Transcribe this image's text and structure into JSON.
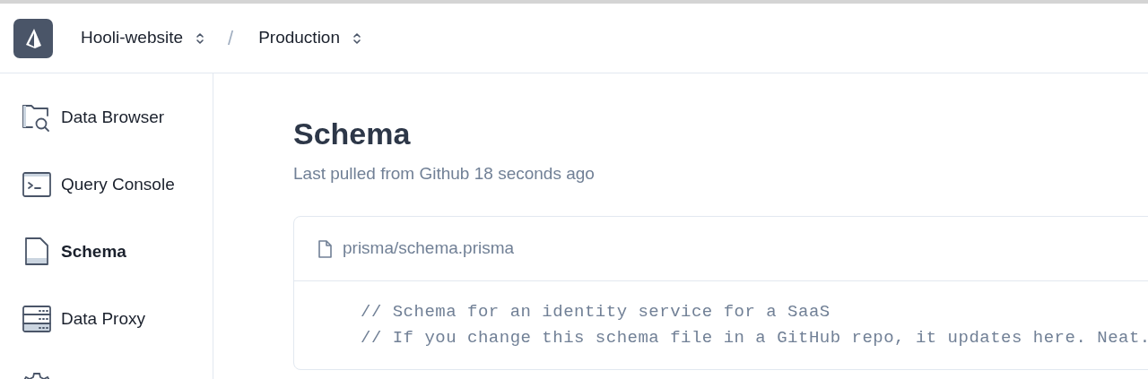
{
  "breadcrumbs": [
    {
      "label": "Hooli-website"
    },
    {
      "label": "Production"
    }
  ],
  "breadcrumb_separator": "/",
  "sidebar": {
    "items": [
      {
        "label": "Data Browser",
        "selected": false
      },
      {
        "label": "Query Console",
        "selected": false
      },
      {
        "label": "Schema",
        "selected": true
      },
      {
        "label": "Data Proxy",
        "selected": false
      }
    ]
  },
  "page": {
    "title": "Schema",
    "subtitle": "Last pulled from Github 18 seconds ago"
  },
  "file": {
    "name": "prisma/schema.prisma",
    "lines": [
      "// Schema for an identity service for a SaaS",
      "// If you change this schema file in a GitHub repo, it updates here. Neat."
    ]
  }
}
